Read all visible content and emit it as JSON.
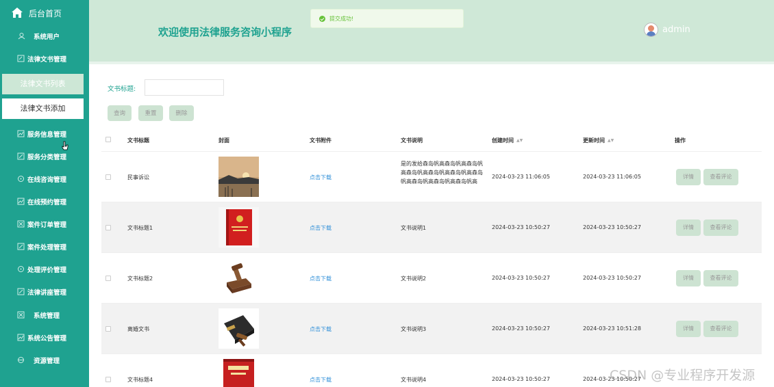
{
  "sidebar": {
    "home_label": "后台首页",
    "items": [
      {
        "label": "系统用户",
        "icon": "user-icon"
      },
      {
        "label": "法律文书管理",
        "icon": "document-icon"
      },
      {
        "label": "服务信息管理",
        "icon": "chart-icon"
      },
      {
        "label": "服务分类管理",
        "icon": "edit-icon"
      },
      {
        "label": "在线咨询管理",
        "icon": "chat-icon"
      },
      {
        "label": "在线预约管理",
        "icon": "chart-icon"
      },
      {
        "label": "案件订单管理",
        "icon": "order-icon"
      },
      {
        "label": "案件处理管理",
        "icon": "edit-icon"
      },
      {
        "label": "处理评价管理",
        "icon": "chat-icon"
      },
      {
        "label": "法律讲座管理",
        "icon": "edit-icon"
      },
      {
        "label": "系统管理",
        "icon": "settings-icon"
      },
      {
        "label": "系统公告管理",
        "icon": "chart-icon"
      },
      {
        "label": "资源管理",
        "icon": "cloud-icon"
      }
    ],
    "sub_items": [
      {
        "label": "法律文书列表"
      },
      {
        "label": "法律文书添加"
      }
    ]
  },
  "header": {
    "title": "欢迎使用法律服务咨询小程序",
    "toast": "提交成功!",
    "username": "admin"
  },
  "search": {
    "label": "文书标题:",
    "value": "",
    "placeholder": ""
  },
  "buttons": {
    "query": "查询",
    "reset": "重置",
    "delete": "删除"
  },
  "table": {
    "headers": [
      "文书标题",
      "封面",
      "文书附件",
      "文书说明",
      "创建时间",
      "更新时间",
      "操作"
    ],
    "rows": [
      {
        "title": "民事诉讼",
        "attachment": "点击下载",
        "desc": "是的发给森岛帆高森岛帆高森岛帆高森岛帆高森岛帆高森岛帆高森岛帆高森岛帆高森岛帆高森岛帆高",
        "created": "2024-03-23 11:06:05",
        "updated": "2024-03-23 11:06:05",
        "cover": "sunset-lake"
      },
      {
        "title": "文书标题1",
        "attachment": "点击下载",
        "desc": "文书说明1",
        "created": "2024-03-23 10:50:27",
        "updated": "2024-03-23 10:50:27",
        "cover": "red-law-book"
      },
      {
        "title": "文书标题2",
        "attachment": "点击下载",
        "desc": "文书说明2",
        "created": "2024-03-23 10:50:27",
        "updated": "2024-03-23 10:50:27",
        "cover": "gavel-law-book"
      },
      {
        "title": "离婚文书",
        "attachment": "点击下载",
        "desc": "文书说明3",
        "created": "2024-03-23 10:50:27",
        "updated": "2024-03-23 10:51:28",
        "cover": "law-book-gavel"
      },
      {
        "title": "文书标题4",
        "attachment": "点击下载",
        "desc": "文书说明4",
        "created": "2024-03-23 10:50:27",
        "updated": "2024-03-23 10:50:27",
        "cover": "economic-law-book"
      }
    ],
    "detail_label": "详情",
    "comment_label": "查看评论"
  },
  "watermark": "CSDN @专业程序开发源"
}
